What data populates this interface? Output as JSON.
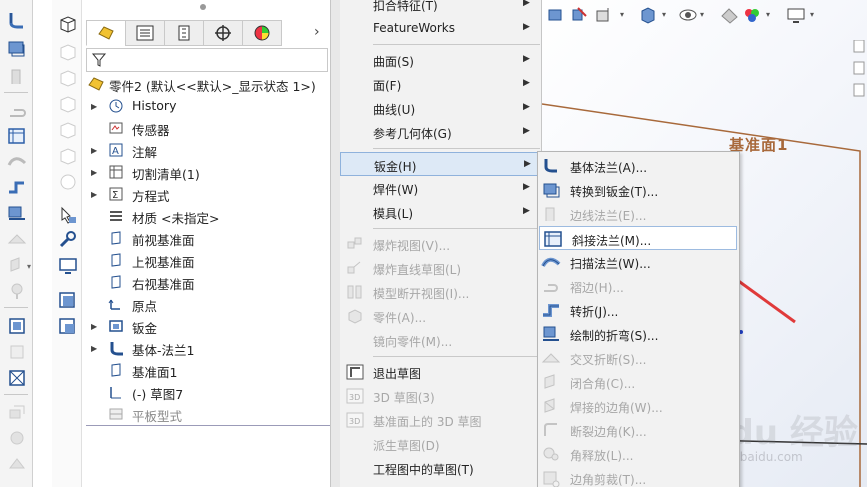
{
  "tree": {
    "part_name": "零件2 (默认<<默认>_显示状态 1>)",
    "items": [
      {
        "label": "History",
        "expandable": true,
        "icon": "history-icon"
      },
      {
        "label": "传感器",
        "expandable": false,
        "icon": "sensor-icon"
      },
      {
        "label": "注解",
        "expandable": true,
        "icon": "annotation-icon"
      },
      {
        "label": "切割清单(1)",
        "expandable": true,
        "icon": "cut-list-icon"
      },
      {
        "label": "方程式",
        "expandable": true,
        "icon": "equation-icon"
      },
      {
        "label": "材质 <未指定>",
        "expandable": false,
        "icon": "material-icon"
      },
      {
        "label": "前视基准面",
        "expandable": false,
        "icon": "plane-icon"
      },
      {
        "label": "上视基准面",
        "expandable": false,
        "icon": "plane-icon"
      },
      {
        "label": "右视基准面",
        "expandable": false,
        "icon": "plane-icon"
      },
      {
        "label": "原点",
        "expandable": false,
        "icon": "origin-icon"
      },
      {
        "label": "钣金",
        "expandable": true,
        "icon": "sheet-metal-folder-icon"
      },
      {
        "label": "基体-法兰1",
        "expandable": true,
        "icon": "base-flange-icon"
      },
      {
        "label": "基准面1",
        "expandable": false,
        "icon": "plane-icon"
      },
      {
        "label": "(-) 草图7",
        "expandable": false,
        "icon": "sketch-icon"
      },
      {
        "label": "平板型式",
        "expandable": false,
        "icon": "flat-pattern-icon",
        "dim": true
      }
    ]
  },
  "insert_menu": {
    "items": [
      {
        "label": "扣合特征(T)",
        "submenu": true,
        "disabled": false
      },
      {
        "label": "FeatureWorks",
        "submenu": true,
        "disabled": false
      },
      {
        "sep": true
      },
      {
        "label": "曲面(S)",
        "submenu": true,
        "disabled": false
      },
      {
        "label": "面(F)",
        "submenu": true,
        "disabled": false
      },
      {
        "label": "曲线(U)",
        "submenu": true,
        "disabled": false
      },
      {
        "label": "参考几何体(G)",
        "submenu": true,
        "disabled": false
      },
      {
        "sep": true
      },
      {
        "label": "钣金(H)",
        "submenu": true,
        "disabled": false,
        "highlight": true
      },
      {
        "label": "焊件(W)",
        "submenu": true,
        "disabled": false
      },
      {
        "label": "模具(L)",
        "submenu": true,
        "disabled": false
      },
      {
        "sep": true
      },
      {
        "label": "爆炸视图(V)...",
        "submenu": false,
        "disabled": true,
        "icon": "explode-view-icon"
      },
      {
        "label": "爆炸直线草图(L)",
        "submenu": false,
        "disabled": true,
        "icon": "explode-line-icon"
      },
      {
        "label": "模型断开视图(I)...",
        "submenu": false,
        "disabled": true,
        "icon": "model-break-icon"
      },
      {
        "label": "零件(A)...",
        "submenu": false,
        "disabled": true,
        "icon": "insert-part-icon"
      },
      {
        "label": "镜向零件(M)...",
        "submenu": false,
        "disabled": true,
        "icon": ""
      },
      {
        "sep": true
      },
      {
        "label": "退出草图",
        "submenu": false,
        "disabled": false,
        "icon": "exit-sketch-icon"
      },
      {
        "label": "3D 草图(3)",
        "submenu": false,
        "disabled": true,
        "icon": "3d-sketch-icon"
      },
      {
        "label": "基准面上的 3D 草图",
        "submenu": false,
        "disabled": true,
        "icon": "3d-sketch-plane-icon"
      },
      {
        "label": "派生草图(D)",
        "submenu": false,
        "disabled": true,
        "icon": ""
      },
      {
        "label": "工程图中的草图(T)",
        "submenu": false,
        "disabled": false,
        "icon": ""
      }
    ]
  },
  "sheetmetal_menu": {
    "items": [
      {
        "label": "基体法兰(A)...",
        "disabled": false,
        "icon": "base-flange-icon"
      },
      {
        "label": "转换到钣金(T)...",
        "disabled": false,
        "icon": "convert-sheet-metal-icon"
      },
      {
        "label": "边线法兰(E)...",
        "disabled": true,
        "icon": "edge-flange-icon"
      },
      {
        "label": "斜接法兰(M)...",
        "disabled": false,
        "icon": "miter-flange-icon",
        "highlight": true
      },
      {
        "label": "扫描法兰(W)...",
        "disabled": false,
        "icon": "swept-flange-icon"
      },
      {
        "label": "褶边(H)...",
        "disabled": true,
        "icon": "hem-icon"
      },
      {
        "label": "转折(J)...",
        "disabled": false,
        "icon": "jog-icon"
      },
      {
        "label": "绘制的折弯(S)...",
        "disabled": false,
        "icon": "sketched-bend-icon"
      },
      {
        "label": "交叉折断(S)...",
        "disabled": true,
        "icon": "cross-break-icon"
      },
      {
        "label": "闭合角(C)...",
        "disabled": true,
        "icon": "closed-corner-icon"
      },
      {
        "label": "焊接的边角(W)...",
        "disabled": true,
        "icon": "welded-corner-icon"
      },
      {
        "label": "断裂边角(K)...",
        "disabled": true,
        "icon": "break-corner-icon"
      },
      {
        "label": "角释放(L)...",
        "disabled": true,
        "icon": "corner-relief-icon"
      },
      {
        "label": "边角剪裁(T)...",
        "disabled": true,
        "icon": "corner-trim-icon"
      }
    ]
  },
  "graphics": {
    "plane_label": "基准面1",
    "watermark": "Baidu 经验",
    "watermark_sub": "jingyan.baidu.com"
  },
  "colors": {
    "plane_border": "#a8693b",
    "arrow": "#e03a3a",
    "highlight_bg": "#dde9f6",
    "disabled_text": "#a7a7a7"
  }
}
